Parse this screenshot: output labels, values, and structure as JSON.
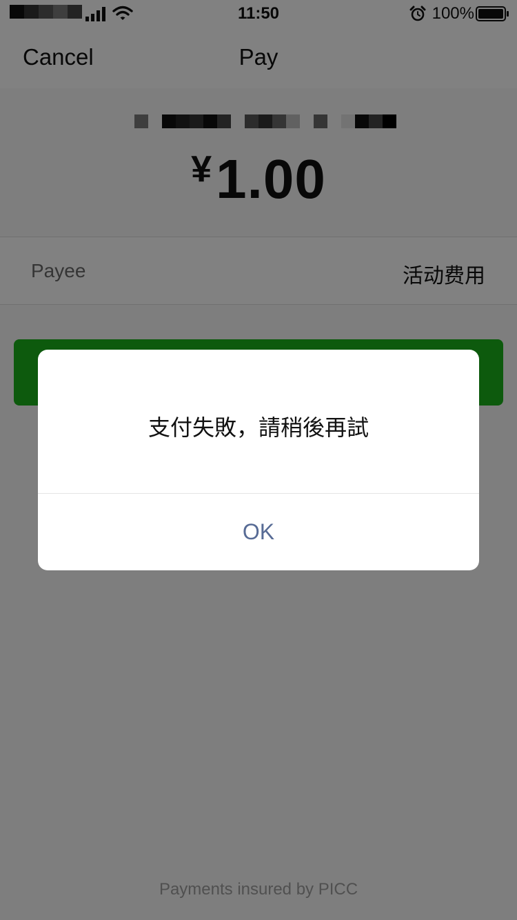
{
  "status_bar": {
    "time": "11:50",
    "battery_percent": "100%",
    "icons": [
      "signal-icon",
      "wifi-icon",
      "alarm-icon",
      "battery-icon"
    ]
  },
  "nav": {
    "cancel_label": "Cancel",
    "title": "Pay"
  },
  "payment": {
    "currency_symbol": "¥",
    "amount": "1.00",
    "payee_label": "Payee",
    "payee_value": "活动费用"
  },
  "alert": {
    "message": "支付失敗，請稍後再試",
    "ok_label": "OK"
  },
  "footer": {
    "note": "Payments insured by PICC"
  },
  "colors": {
    "accent_green": "#1aad19",
    "link_blue": "#576b95",
    "overlay": "rgba(0,0,0,0.48)"
  }
}
